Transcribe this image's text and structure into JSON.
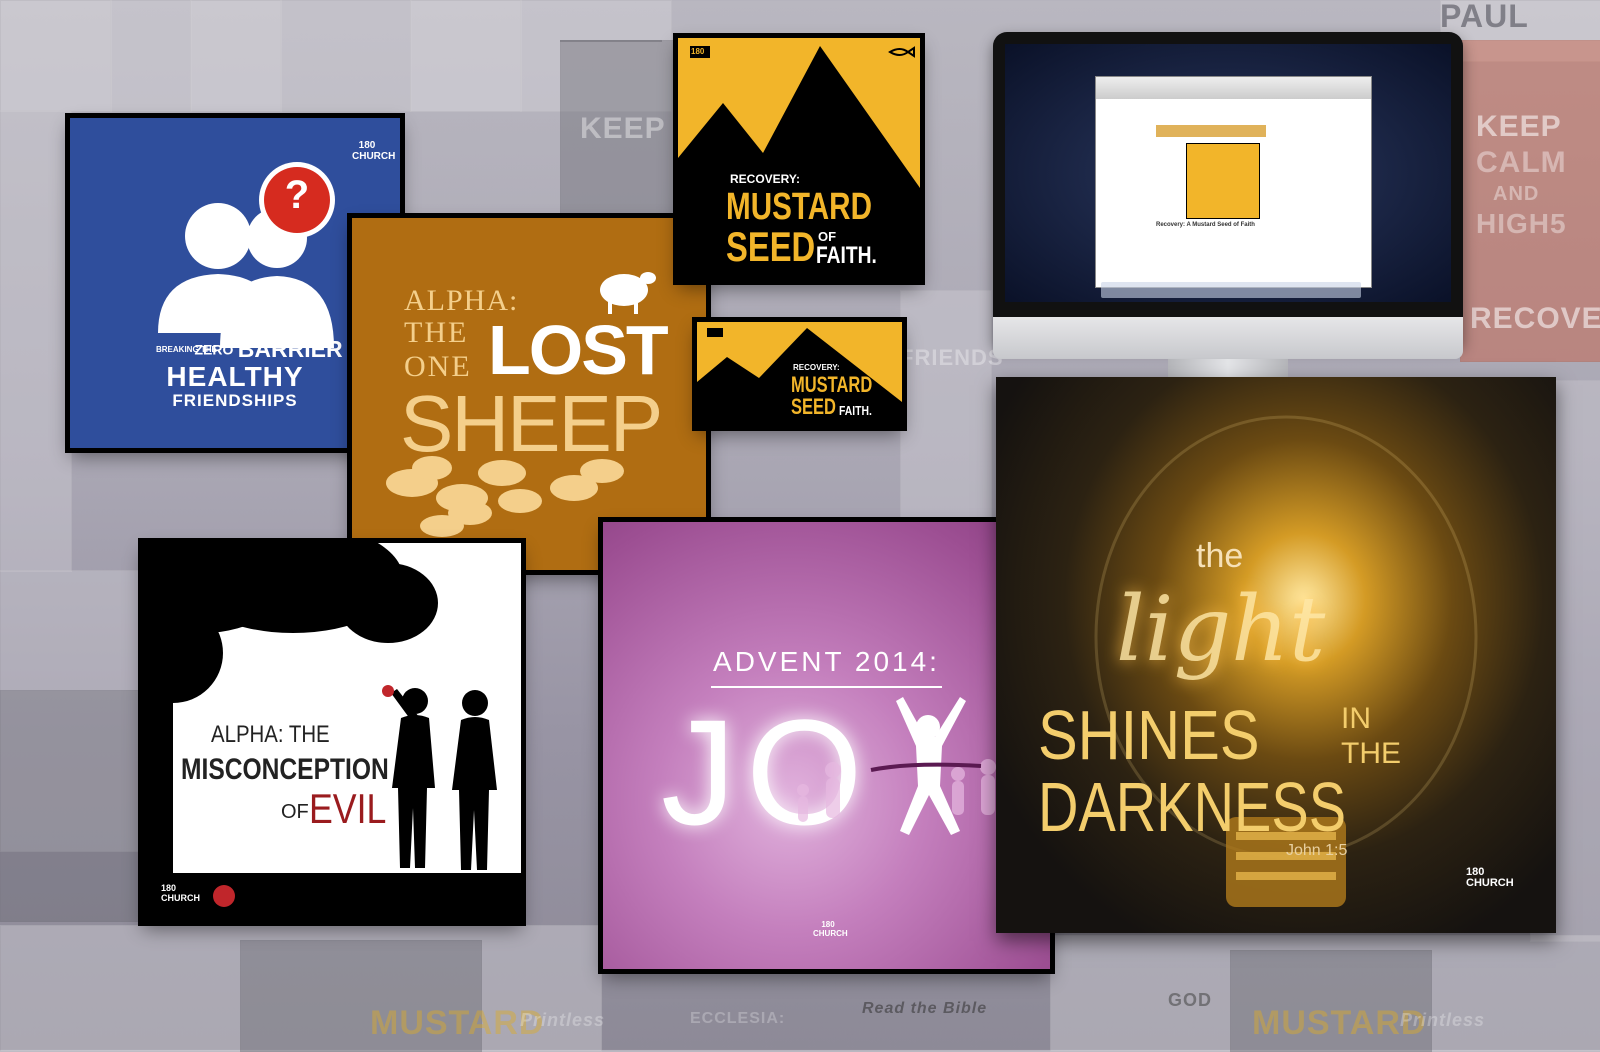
{
  "background": {
    "tiles_text": [
      "PAUL",
      "KEEP",
      "CALM",
      "AND",
      "HIGH5",
      "RECOVE",
      "FRIENDS",
      "MUSTARD",
      "Printless",
      "Read the Bible",
      "GOD",
      "ECCLESIA:"
    ],
    "colors": {
      "base": "#a9a6b3"
    }
  },
  "cards": {
    "healthy": {
      "logo": "180 CHURCH",
      "badge": "?",
      "line1a": "BREAKING THE",
      "line1b": "ZERO",
      "line1c": "BARRIER",
      "line2": "HEALTHY",
      "line3": "FRIENDSHIPS",
      "icon": "people-silhouette-icon",
      "color": "#2f4e9c"
    },
    "sheep": {
      "line1": "ALPHA:",
      "line2": "THE",
      "line3": "ONE",
      "line4": "LOST",
      "line5": "SHEEP",
      "icon": "sheep-icon",
      "color": "#b06d12"
    },
    "mustard": {
      "label": "RECOVERY:",
      "line1": "MUSTARD",
      "line2": "SEED",
      "of": "OF",
      "faith": "FAITH.",
      "badge": "180",
      "icon": "fish-icon",
      "color": "#f2b52a"
    },
    "evil": {
      "line1": "ALPHA: THE",
      "line2": "MISCONCEPTION",
      "of": "OF",
      "line3": "EVIL",
      "logo": "180 CHURCH",
      "icon": "tree-silhouette-icon"
    },
    "joy": {
      "title": "ADVENT 2014:",
      "word": "JO",
      "logo": "180 CHURCH",
      "icon": "runner-icon"
    },
    "light": {
      "the": "the",
      "light": "light",
      "shines": "SHINES",
      "inthe1": "IN",
      "inthe2": "THE",
      "darkness": "DARKNESS",
      "ref": "John 1:5",
      "logo": "180 CHURCH",
      "icon": "lightbulb-icon"
    },
    "imac": {
      "email_title": "Recovery: A Mustard Seed of Faith",
      "icon": "monitor-icon"
    }
  }
}
